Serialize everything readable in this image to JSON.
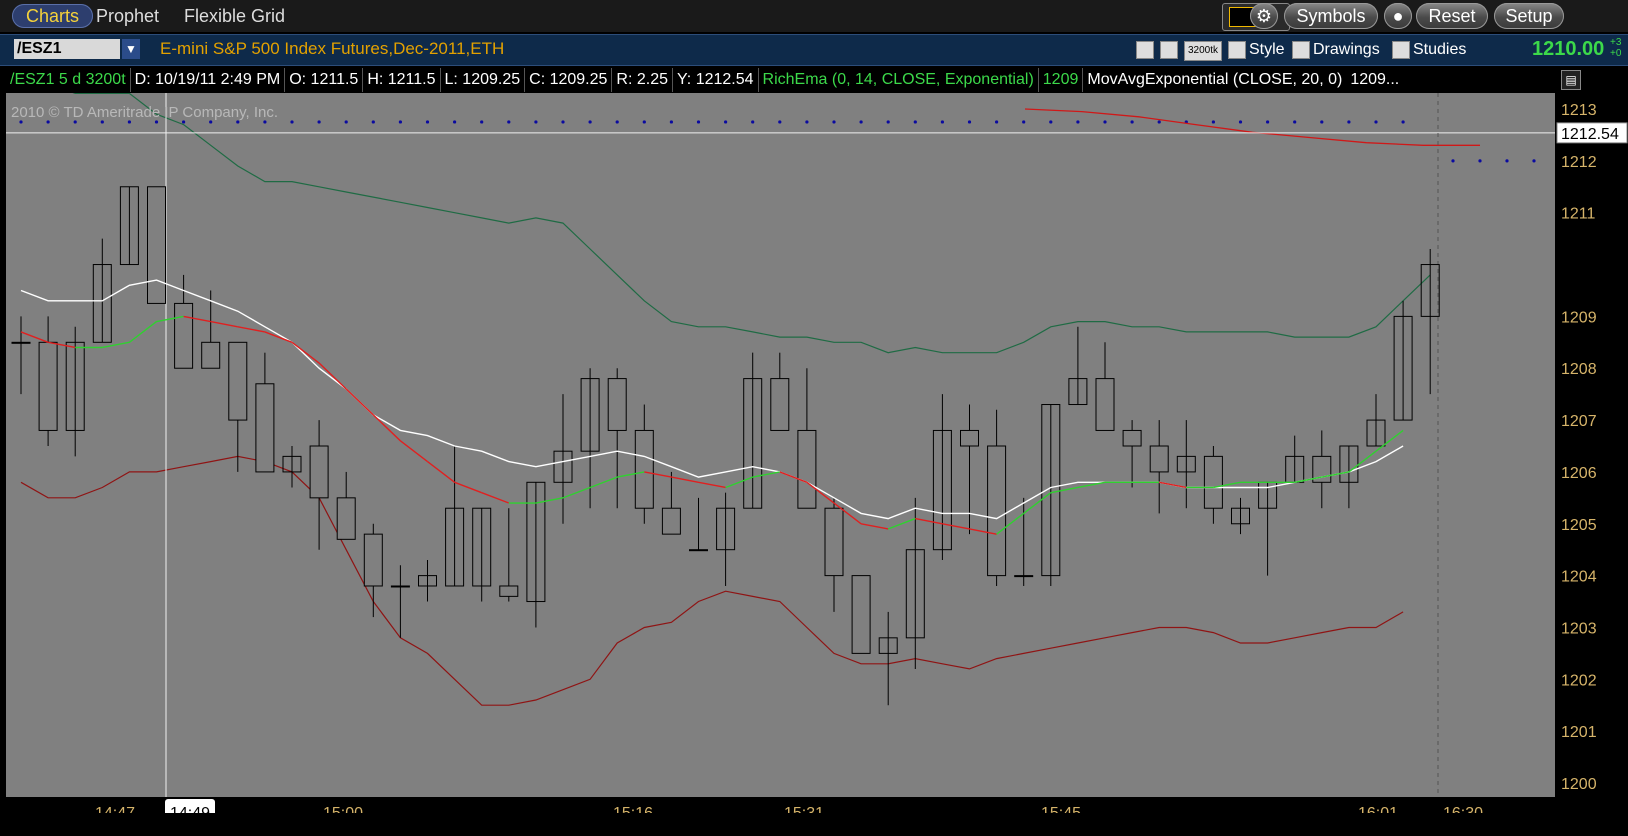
{
  "nav": {
    "tabs": [
      "Charts",
      "Prophet",
      "Flexible Grid"
    ],
    "buttons": {
      "symbols": "Symbols",
      "reset": "Reset",
      "setup": "Setup"
    }
  },
  "symbol_bar": {
    "symbol": "/ESZ1",
    "description": "E-mini S&P 500 Index Futures,Dec-2011,ETH",
    "aggregation": "3200tk",
    "style": "Style",
    "drawings": "Drawings",
    "studies": "Studies",
    "last_price": "1210.00",
    "change_top": "+3",
    "change_bottom": "+0"
  },
  "info_bar": {
    "symbol_period": "/ESZ1 5 d 3200t",
    "date": "D: 10/19/11 2:49 PM",
    "open": "O: 1211.5",
    "high": "H: 1211.5",
    "low": "L: 1209.25",
    "close": "C: 1209.25",
    "range": "R: 2.25",
    "y": "Y: 1212.54",
    "study1": "RichEma (0, 14, CLOSE, Exponential)",
    "study1_value": "1209",
    "study2": "MovAvgExponential (CLOSE, 20, 0)",
    "study2_value": "1209..."
  },
  "copyright": "2010 © TD Ameritrade IP Company, Inc.",
  "colors": {
    "chart_bg": "#808080",
    "price_axis_text": "#d6b46a",
    "up_ema": "#2fd12f",
    "down_ema": "#e02020",
    "ema20": "#ffffff",
    "upper_band": "#1f6b44",
    "lower_band": "#8f1414",
    "dots": "#0a0aa0",
    "long_ma": "#d01818",
    "accent": "#f5d23a"
  },
  "chart_data": {
    "type": "candlestick",
    "y_ticks": [
      1213,
      1212,
      1211,
      1209,
      1208,
      1207,
      1206,
      1205,
      1204,
      1203,
      1202,
      1201,
      1200
    ],
    "x_labels": [
      "14:47",
      "14:49",
      "15:00",
      "15:16",
      "15:31",
      "15:45",
      "16:01",
      "16:30"
    ],
    "cursor_price": "1212.54",
    "cursor_time": "14:49",
    "ylim": [
      1199.75,
      1213.5
    ],
    "candles": [
      [
        1208.5,
        1209.0,
        1207.5,
        1208.5
      ],
      [
        1208.5,
        1209.0,
        1206.5,
        1206.8
      ],
      [
        1206.8,
        1208.8,
        1206.3,
        1208.5
      ],
      [
        1208.5,
        1210.5,
        1208.5,
        1210.0
      ],
      [
        1210.0,
        1211.5,
        1210.0,
        1211.5
      ],
      [
        1211.5,
        1211.5,
        1209.25,
        1209.25
      ],
      [
        1209.25,
        1209.8,
        1208.0,
        1208.0
      ],
      [
        1208.5,
        1209.5,
        1208.0,
        1208.0
      ],
      [
        1208.5,
        1208.5,
        1206.0,
        1207.0
      ],
      [
        1207.7,
        1208.3,
        1206.0,
        1206.0
      ],
      [
        1206.0,
        1206.5,
        1205.7,
        1206.3
      ],
      [
        1206.5,
        1207.0,
        1204.5,
        1205.5
      ],
      [
        1205.5,
        1206.0,
        1204.7,
        1204.7
      ],
      [
        1204.8,
        1205.0,
        1203.2,
        1203.8
      ],
      [
        1203.8,
        1204.2,
        1202.8,
        1203.8
      ],
      [
        1203.8,
        1204.3,
        1203.5,
        1204.0
      ],
      [
        1203.8,
        1206.5,
        1203.8,
        1205.3
      ],
      [
        1203.8,
        1205.3,
        1203.5,
        1205.3
      ],
      [
        1203.8,
        1205.3,
        1203.5,
        1203.6
      ],
      [
        1203.5,
        1205.8,
        1203.0,
        1205.8
      ],
      [
        1205.8,
        1207.5,
        1205.0,
        1206.4
      ],
      [
        1206.4,
        1208.0,
        1205.3,
        1207.8
      ],
      [
        1207.8,
        1208.0,
        1205.3,
        1206.8
      ],
      [
        1206.8,
        1207.3,
        1205.0,
        1205.3
      ],
      [
        1205.3,
        1206.0,
        1204.8,
        1204.8
      ],
      [
        1204.5,
        1205.5,
        1204.5,
        1204.5
      ],
      [
        1204.5,
        1205.6,
        1203.8,
        1205.3
      ],
      [
        1205.3,
        1208.3,
        1205.3,
        1207.8
      ],
      [
        1207.8,
        1208.3,
        1206.8,
        1206.8
      ],
      [
        1206.8,
        1208.0,
        1205.3,
        1205.3
      ],
      [
        1205.3,
        1205.5,
        1203.3,
        1204.0
      ],
      [
        1204.0,
        1203.0,
        1202.5,
        1202.5
      ],
      [
        1202.5,
        1203.3,
        1201.5,
        1202.8
      ],
      [
        1202.8,
        1205.5,
        1202.2,
        1204.5
      ],
      [
        1204.5,
        1207.5,
        1204.3,
        1206.8
      ],
      [
        1206.8,
        1207.3,
        1204.8,
        1206.5
      ],
      [
        1206.5,
        1207.2,
        1203.8,
        1204.0
      ],
      [
        1204.0,
        1205.5,
        1203.8,
        1204.0
      ],
      [
        1204.0,
        1207.3,
        1203.8,
        1207.3
      ],
      [
        1207.3,
        1208.8,
        1207.3,
        1207.8
      ],
      [
        1207.8,
        1208.5,
        1206.8,
        1206.8
      ],
      [
        1206.8,
        1207.0,
        1205.7,
        1206.5
      ],
      [
        1206.5,
        1207.0,
        1205.2,
        1206.0
      ],
      [
        1206.0,
        1207.0,
        1205.3,
        1206.3
      ],
      [
        1206.3,
        1206.5,
        1205.0,
        1205.3
      ],
      [
        1205.0,
        1205.5,
        1204.8,
        1205.3
      ],
      [
        1205.3,
        1205.8,
        1204.0,
        1205.8
      ],
      [
        1205.8,
        1206.7,
        1205.8,
        1206.3
      ],
      [
        1206.3,
        1206.8,
        1205.3,
        1205.8
      ],
      [
        1205.8,
        1206.5,
        1205.3,
        1206.5
      ],
      [
        1206.5,
        1207.5,
        1206.5,
        1207.0
      ],
      [
        1207.0,
        1209.3,
        1207.0,
        1209.0
      ],
      [
        1209.0,
        1210.3,
        1207.5,
        1210.0
      ]
    ],
    "ema20": [
      1209.5,
      1209.3,
      1209.3,
      1209.3,
      1209.6,
      1209.7,
      1209.5,
      1209.3,
      1209.1,
      1208.8,
      1208.5,
      1208.0,
      1207.6,
      1207.1,
      1206.8,
      1206.7,
      1206.5,
      1206.4,
      1206.2,
      1206.1,
      1206.2,
      1206.3,
      1206.4,
      1206.3,
      1206.1,
      1205.9,
      1206.0,
      1206.1,
      1206.0,
      1205.8,
      1205.5,
      1205.2,
      1205.1,
      1205.3,
      1205.2,
      1205.2,
      1205.1,
      1205.4,
      1205.7,
      1205.8,
      1205.8,
      1205.8,
      1205.8,
      1205.7,
      1205.7,
      1205.7,
      1205.7,
      1205.8,
      1205.9,
      1206.0,
      1206.2,
      1206.5
    ],
    "rich_ema": [
      1208.7,
      1208.5,
      1208.4,
      1208.4,
      1208.5,
      1208.9,
      1209.0,
      1208.9,
      1208.8,
      1208.7,
      1208.5,
      1208.1,
      1207.6,
      1207.1,
      1206.6,
      1206.2,
      1205.8,
      1205.6,
      1205.4,
      1205.4,
      1205.5,
      1205.7,
      1205.9,
      1206.0,
      1205.9,
      1205.8,
      1205.7,
      1205.9,
      1206.0,
      1205.8,
      1205.4,
      1205.0,
      1204.9,
      1205.1,
      1205.0,
      1204.9,
      1204.8,
      1205.2,
      1205.6,
      1205.7,
      1205.8,
      1205.8,
      1205.8,
      1205.7,
      1205.7,
      1205.8,
      1205.8,
      1205.8,
      1205.9,
      1206.0,
      1206.4,
      1206.8
    ],
    "upper_band": [
      1213.8,
      1213.5,
      1213.3,
      1213.3,
      1213.3,
      1212.9,
      1212.7,
      1212.3,
      1211.9,
      1211.6,
      1211.6,
      1211.5,
      1211.4,
      1211.3,
      1211.2,
      1211.1,
      1211.0,
      1210.9,
      1210.8,
      1210.9,
      1210.8,
      1210.3,
      1209.8,
      1209.3,
      1208.9,
      1208.8,
      1208.8,
      1208.7,
      1208.6,
      1208.6,
      1208.5,
      1208.5,
      1208.3,
      1208.4,
      1208.3,
      1208.3,
      1208.3,
      1208.5,
      1208.8,
      1208.9,
      1208.9,
      1208.8,
      1208.8,
      1208.7,
      1208.7,
      1208.7,
      1208.7,
      1208.6,
      1208.6,
      1208.6,
      1208.8,
      1209.3,
      1209.8
    ],
    "lower_band": [
      1205.8,
      1205.5,
      1205.5,
      1205.7,
      1206.0,
      1206.0,
      1206.1,
      1206.2,
      1206.3,
      1206.2,
      1206.0,
      1205.5,
      1204.5,
      1203.5,
      1202.8,
      1202.5,
      1202.0,
      1201.5,
      1201.5,
      1201.6,
      1201.8,
      1202.0,
      1202.7,
      1203.0,
      1203.1,
      1203.5,
      1203.7,
      1203.6,
      1203.5,
      1203.0,
      1202.5,
      1202.3,
      1202.3,
      1202.4,
      1202.3,
      1202.2,
      1202.4,
      1202.5,
      1202.6,
      1202.7,
      1202.8,
      1202.9,
      1203.0,
      1203.0,
      1202.9,
      1202.7,
      1202.7,
      1202.8,
      1202.9,
      1203.0,
      1203.0,
      1203.3
    ],
    "long_ma": [
      1213.0,
      1212.95,
      1212.85,
      1212.7,
      1212.55,
      1212.45,
      1212.35,
      1212.3,
      1212.3
    ],
    "dot_level": 1212.75,
    "dot_level_right": 1212.0
  }
}
